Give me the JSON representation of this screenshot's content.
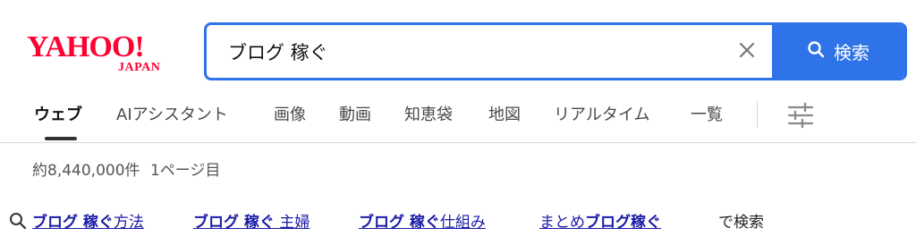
{
  "logo": {
    "main": "YAHOO!",
    "sub": "JAPAN"
  },
  "search": {
    "value": "ブログ 稼ぐ",
    "button_label": "検索"
  },
  "tabs": [
    {
      "label": "ウェブ",
      "active": true
    },
    {
      "label": "AIアシスタント"
    },
    {
      "label": "画像"
    },
    {
      "label": "動画"
    },
    {
      "label": "知恵袋"
    },
    {
      "label": "地図"
    },
    {
      "label": "リアルタイム"
    },
    {
      "label": "一覧"
    }
  ],
  "results": {
    "count_text": "約8,440,000件",
    "page_text": "1ページ目"
  },
  "related": {
    "items": [
      {
        "bold": "ブログ 稼ぐ",
        "rest": "方法",
        "bold_first": true
      },
      {
        "bold": "ブログ 稼ぐ",
        "rest": " 主婦",
        "bold_first": true
      },
      {
        "bold": "ブログ 稼ぐ",
        "rest": "仕組み",
        "bold_first": true
      },
      {
        "bold": "ブログ稼ぐ",
        "rest": "まとめ",
        "bold_first": false
      }
    ],
    "suffix": "で検索"
  },
  "colors": {
    "accent": "#2f73e8",
    "brand": "#ff0033",
    "link": "#1a1aa6"
  }
}
